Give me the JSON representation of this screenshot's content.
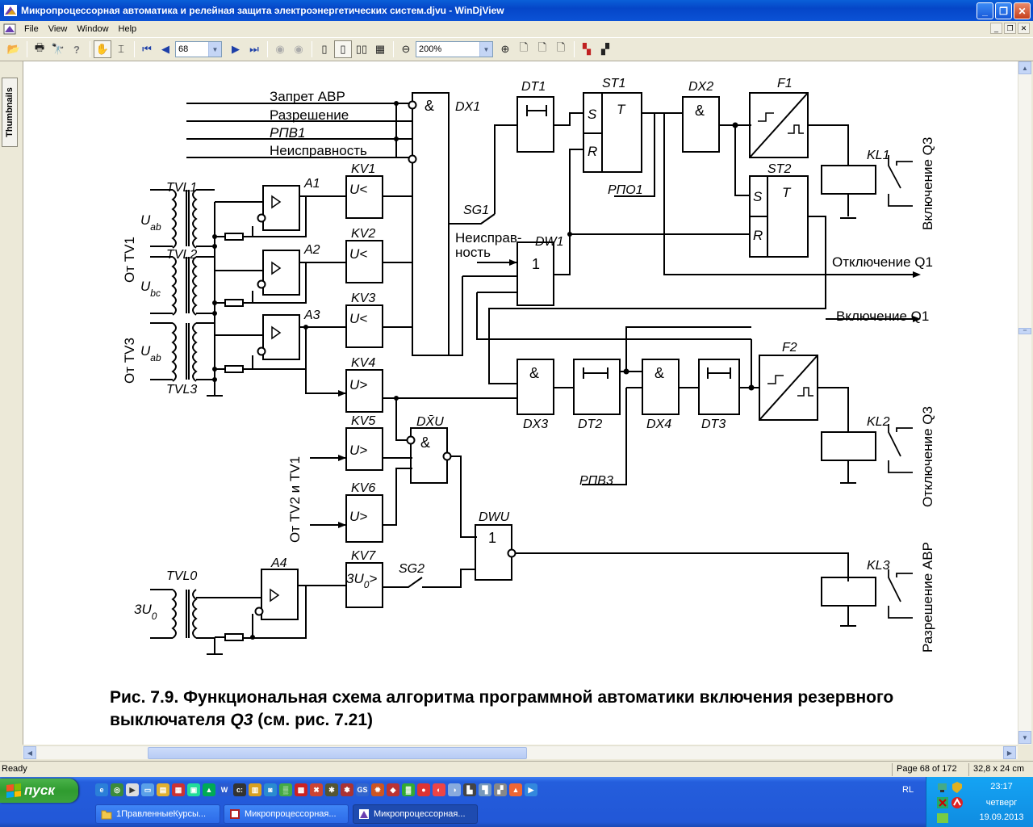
{
  "window": {
    "title": "Микропроцессорная автоматика и релейная защита электроэнергетических систем.djvu - WinDjView"
  },
  "menu": [
    "File",
    "View",
    "Window",
    "Help"
  ],
  "toolbar": {
    "page_value": "68",
    "zoom_value": "200%"
  },
  "sidebar": {
    "tab_label": "Thumbnails"
  },
  "document": {
    "inputs": [
      "Запрет АВР",
      "Разрешение",
      "РПВ1",
      "Неисправность"
    ],
    "blocks": {
      "dx1": "DX1",
      "dt1": "DT1",
      "st1": "ST1",
      "dx2": "DX2",
      "f1": "F1",
      "st2": "ST2",
      "kl1": "KL1",
      "sg1": "SG1",
      "dw1": "DW1",
      "dx3": "DX3",
      "dt2": "DT2",
      "dx4": "DX4",
      "dt3": "DT3",
      "f2": "F2",
      "kl2": "KL2",
      "dxu": "DX̄U",
      "dwu": "DWU",
      "kl3": "KL3",
      "a1": "A1",
      "a2": "A2",
      "a3": "A3",
      "a4": "A4",
      "kv1": "KV1",
      "kv2": "KV2",
      "kv3": "KV3",
      "kv4": "KV4",
      "kv5": "KV5",
      "kv6": "KV6",
      "kv7": "KV7",
      "tvl1": "TVL1",
      "tvl2": "TVL2",
      "tvl3": "TVL3",
      "tvl0": "TVL0",
      "sg2": "SG2"
    },
    "symbols": {
      "and": "&",
      "or": "1",
      "u_less": "U<",
      "u_greater": "U>",
      "u0_greater": "3U",
      "u0_sub": "0",
      "u0_tail": ">",
      "S": "S",
      "T": "T",
      "R": "R"
    },
    "voltages": {
      "uab": "U",
      "ab": "ab",
      "ubc": "U",
      "bc": "bc",
      "u0pre": "3U",
      "u0sub": "0"
    },
    "sources": {
      "tv1": "От TV1",
      "tv3": "От TV3",
      "tv2tv1": "От TV2 и TV1"
    },
    "labels": {
      "neispr_1": "Неисправ-",
      "neispr_2": "ность",
      "rpo1": "РПО1",
      "rpv3": "РПВ3",
      "off_q1": "Отключение Q1",
      "on_q1": "Включение Q1",
      "on_q3": "Включение Q3",
      "off_q3": "Отключение Q3",
      "perm_avr": "Разрешение АВР"
    },
    "caption_line1": "Рис. 7.9. Функциональная схема алгоритма программной автоматики включения резервного",
    "caption_line2a": "выключателя ",
    "caption_line2b": "Q3",
    "caption_line2c": " (см. рис. 7.21)"
  },
  "status": {
    "ready": "Ready",
    "page": "Page 68 of 172",
    "size": "32,8 x 24 cm"
  },
  "taskbar": {
    "start": "пуск",
    "tasks": [
      "1ПравленныеКурсы...",
      "Микропроцессорная...",
      "Микропроцессорная..."
    ],
    "lang": "RL",
    "time": "23:17",
    "day": "четверг",
    "date": "19.09.2013"
  }
}
